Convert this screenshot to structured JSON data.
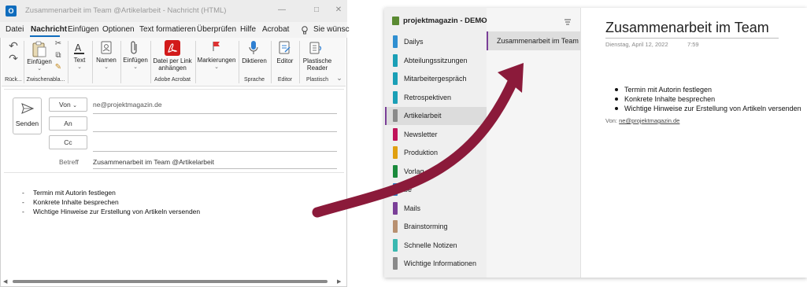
{
  "outlook": {
    "title": "Zusammenarbeit im Team @Artikelarbeit  -  Nachricht (HTML)",
    "logo": "O",
    "menu": [
      "Datei",
      "Nachricht",
      "Einfügen",
      "Optionen",
      "Text formatieren",
      "Überprüfen",
      "Hilfe",
      "Acrobat"
    ],
    "search_hint": "Sie wünsc",
    "ribbon": {
      "einfuegen": "Einfügen",
      "text": "Text",
      "namen": "Namen",
      "einfuegen2": "Einfügen",
      "datei_link": [
        "Datei per Link",
        "anhängen"
      ],
      "markierungen": "Markierungen",
      "diktieren": "Diktieren",
      "editor": "Editor",
      "plastische": [
        "Plastische",
        "Reader"
      ],
      "groups": {
        "rueck": "Rück...",
        "zwischen": "Zwischenabla...",
        "adobe": "Adobe Acrobat",
        "sprache": "Sprache",
        "editor": "Editor",
        "plastisch": "Plastisch"
      }
    },
    "compose": {
      "send": "Senden",
      "from_button": "Von",
      "from_value": "ne@projektmagazin.de",
      "to": "An",
      "cc": "Cc",
      "subject_label": "Betreff",
      "subject_value": "Zusammenarbeit im Team @Artikelarbeit"
    },
    "body": [
      "Termin mit Autorin festlegen",
      "Konkrete Inhalte besprechen",
      "Wichtige Hinweise zur Erstellung von Artikeln versenden"
    ],
    "bullet_char": "-"
  },
  "onenote": {
    "notebook": "projektmagazin - DEMO",
    "sections": [
      {
        "label": "Dailys",
        "color": "#2f8fd1"
      },
      {
        "label": "Abteilungssitzungen",
        "color": "#1a9fb6"
      },
      {
        "label": "Mitarbeitergespräch",
        "color": "#1a9fb6"
      },
      {
        "label": "Retrospektiven",
        "color": "#1a9fb6"
      },
      {
        "label": "Artikelarbeit",
        "color": "#8a8a8a"
      },
      {
        "label": "Newsletter",
        "color": "#c0135a"
      },
      {
        "label": "Produktion",
        "color": "#e0a010"
      },
      {
        "label": "Vorlag",
        "color": "#1a8a3c"
      },
      {
        "label": "be",
        "color": "#2f7fc1"
      },
      {
        "label": "Mails",
        "color": "#7a3f98"
      },
      {
        "label": "Brainstorming",
        "color": "#b89070"
      },
      {
        "label": "Schnelle Notizen",
        "color": "#3ab8b0"
      },
      {
        "label": "Wichtige Informationen",
        "color": "#8a8a8a"
      }
    ],
    "active_section_index": 4,
    "pages": [
      "Zusammenarbeit im Team"
    ],
    "page_title": "Zusammenarbeit im Team",
    "date": "Dienstag, April 12, 2022",
    "time": "7:59",
    "bullets": [
      "Termin mit Autorin festlegen",
      "Konkrete Inhalte besprechen",
      "Wichtige Hinweise zur Erstellung von Artikeln versenden"
    ],
    "from_label": "Von:",
    "from_value": "ne@projektmagazin.de"
  },
  "colors": {
    "arrow": "#8b1a3a",
    "outlook_blue": "#0f6cbd",
    "acrobat_red": "#d21a1a",
    "onenote_purple": "#7a3f98"
  }
}
